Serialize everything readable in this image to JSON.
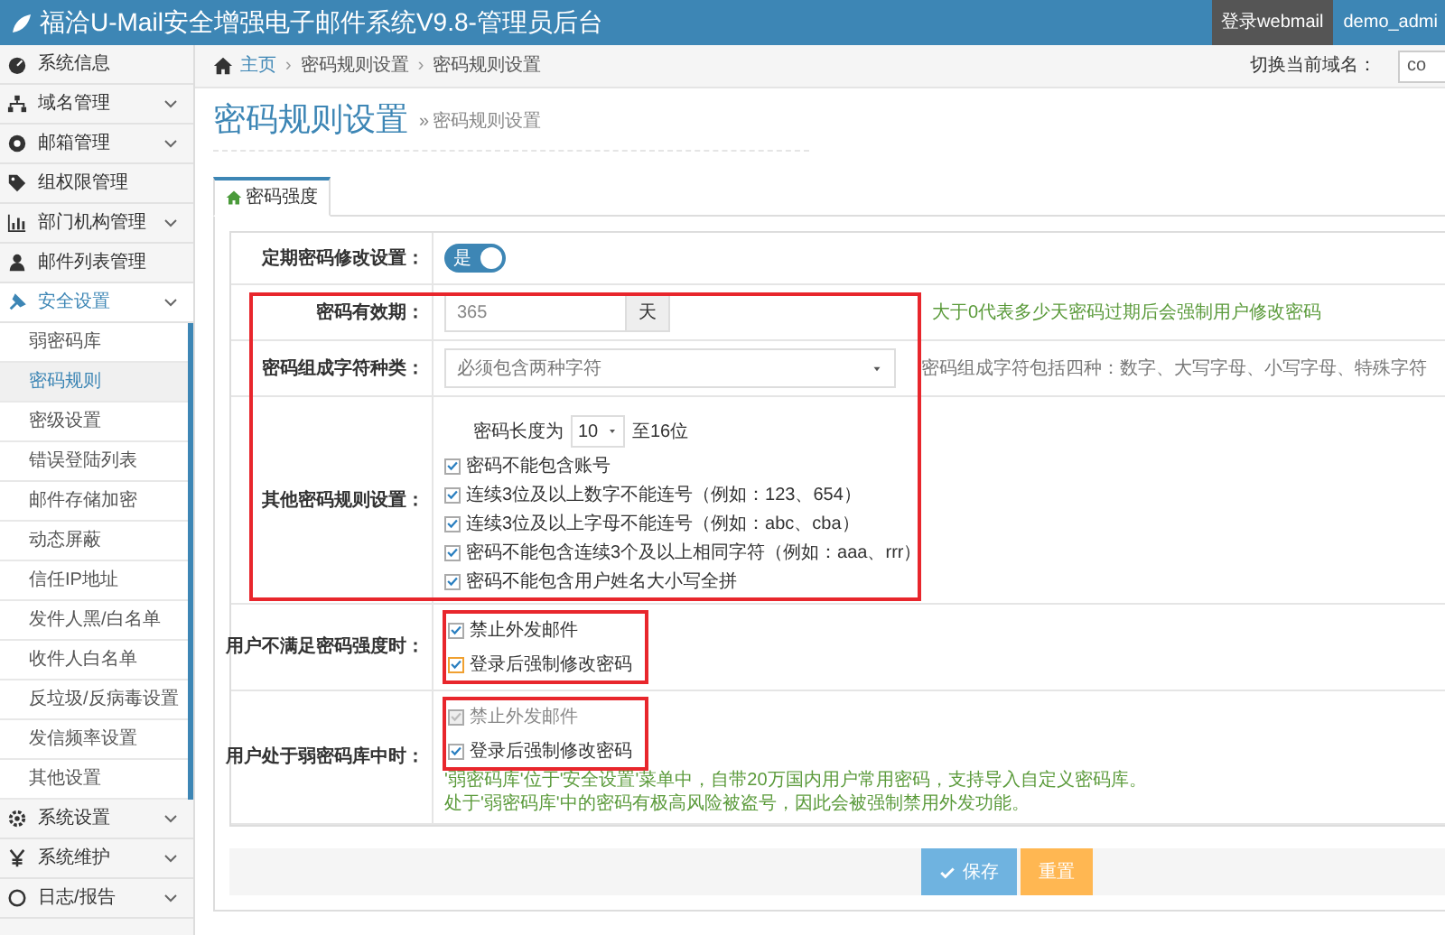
{
  "header": {
    "title": "福洽U-Mail安全增强电子邮件系统V9.8-管理员后台",
    "webmail_link": "登录webmail",
    "user": "demo_admi"
  },
  "sidebar": {
    "items": [
      {
        "label": "系统信息",
        "expandable": false,
        "expanded": false
      },
      {
        "label": "域名管理",
        "expandable": true,
        "expanded": false
      },
      {
        "label": "邮箱管理",
        "expandable": true,
        "expanded": false
      },
      {
        "label": "组权限管理",
        "expandable": false,
        "expanded": false
      },
      {
        "label": "部门机构管理",
        "expandable": true,
        "expanded": false
      },
      {
        "label": "邮件列表管理",
        "expandable": false,
        "expanded": false
      },
      {
        "label": "安全设置",
        "expandable": true,
        "expanded": true,
        "children": [
          {
            "label": "弱密码库",
            "selected": false
          },
          {
            "label": "密码规则",
            "selected": true
          },
          {
            "label": "密级设置",
            "selected": false
          },
          {
            "label": "错误登陆列表",
            "selected": false
          },
          {
            "label": "邮件存储加密",
            "selected": false
          },
          {
            "label": "动态屏蔽",
            "selected": false
          },
          {
            "label": "信任IP地址",
            "selected": false
          },
          {
            "label": "发件人黑/白名单",
            "selected": false
          },
          {
            "label": "收件人白名单",
            "selected": false
          },
          {
            "label": "反垃圾/反病毒设置",
            "selected": false
          },
          {
            "label": "发信频率设置",
            "selected": false
          },
          {
            "label": "其他设置",
            "selected": false
          }
        ]
      },
      {
        "label": "系统设置",
        "expandable": true,
        "expanded": false
      },
      {
        "label": "系统维护",
        "expandable": true,
        "expanded": false
      },
      {
        "label": "日志/报告",
        "expandable": true,
        "expanded": false
      }
    ]
  },
  "breadcrumb": {
    "items": [
      "主页",
      "密码规则设置",
      "密码规则设置"
    ],
    "separator": "›",
    "domain_label": "切换当前域名：",
    "domain_value": "co"
  },
  "page": {
    "title": "密码规则设置",
    "subtitle_marker": "»",
    "subtitle": "密码规则设置"
  },
  "tabs": [
    {
      "label": "密码强度",
      "selected": true
    }
  ],
  "form": {
    "sections": [
      {
        "highlighted": false,
        "rows": [
          {
            "kind": "toggle",
            "label": "定期密码修改设置：",
            "toggle_text": "是",
            "on": true
          }
        ]
      },
      {
        "highlighted": true,
        "rows": [
          {
            "kind": "number",
            "label": "密码有效期：",
            "value": "365",
            "unit": "天",
            "hint": "大于0代表多少天密码过期后会强制用户修改密码"
          },
          {
            "kind": "select",
            "label": "密码组成字符种类：",
            "value": "必须包含两种字符",
            "hint": "密码组成字符包括四种：数字、大写字母、小写字母、特殊字符"
          },
          {
            "kind": "rules",
            "label": "其他密码规则设置：",
            "length_prefix": "密码长度为",
            "length_value": "10",
            "length_suffix": "至16位",
            "checks": [
              {
                "label": "密码不能包含账号",
                "checked": true,
                "disabled": false,
                "focused": false
              },
              {
                "label": "连续3位及以上数字不能连号（例如：123、654）",
                "checked": true,
                "disabled": false,
                "focused": false
              },
              {
                "label": "连续3位及以上字母不能连号（例如：abc、cba）",
                "checked": true,
                "disabled": false,
                "focused": false
              },
              {
                "label": "密码不能包含连续3个及以上相同字符（例如：aaa、rrr）",
                "checked": true,
                "disabled": false,
                "focused": false
              },
              {
                "label": "密码不能包含用户姓名大小写全拼",
                "checked": true,
                "disabled": false,
                "focused": false
              }
            ]
          }
        ]
      },
      {
        "highlighted": false,
        "rows": [
          {
            "kind": "checks",
            "label": "用户不满足密码强度时：",
            "highlighted": true,
            "checks": [
              {
                "label": "禁止外发邮件",
                "checked": true,
                "disabled": false,
                "focused": false
              },
              {
                "label": "登录后强制修改密码",
                "checked": true,
                "disabled": false,
                "focused": true
              }
            ]
          },
          {
            "kind": "checks",
            "label": "用户处于弱密码库中时：",
            "highlighted": true,
            "checks": [
              {
                "label": "禁止外发邮件",
                "checked": true,
                "disabled": true,
                "focused": false
              },
              {
                "label": "登录后强制修改密码",
                "checked": true,
                "disabled": false,
                "focused": false
              }
            ],
            "notes": [
              "'弱密码库'位于'安全设置'菜单中，自带20万国内用户常用密码，支持导入自定义密码库。",
              "处于'弱密码库'中的密码有极高风险被盗号，因此会被强制禁用外发功能。"
            ]
          }
        ]
      }
    ]
  },
  "buttons": [
    {
      "kind": "save",
      "label": "保存"
    },
    {
      "kind": "reset",
      "label": "重置"
    }
  ]
}
